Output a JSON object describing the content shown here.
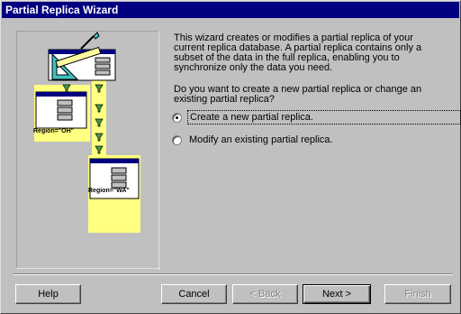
{
  "window": {
    "title": "Partial Replica Wizard"
  },
  "description": "This wizard creates or modifies a partial replica of your current replica database. A partial replica contains only a subset of the data in the full replica, enabling you to synchronize only the data you need.",
  "question": "Do you want to create a new partial replica or change an existing partial replica?",
  "options": [
    {
      "label": "Create a new partial replica.",
      "checked": true
    },
    {
      "label": "Modify an existing partial replica.",
      "checked": false
    }
  ],
  "illustration": {
    "region_oh": "Region=\"OH\"",
    "region_wa": "Region=\"WA\""
  },
  "buttons": {
    "help": "Help",
    "cancel": "Cancel",
    "back": "< Back",
    "next": "Next >",
    "finish": "Finish"
  }
}
